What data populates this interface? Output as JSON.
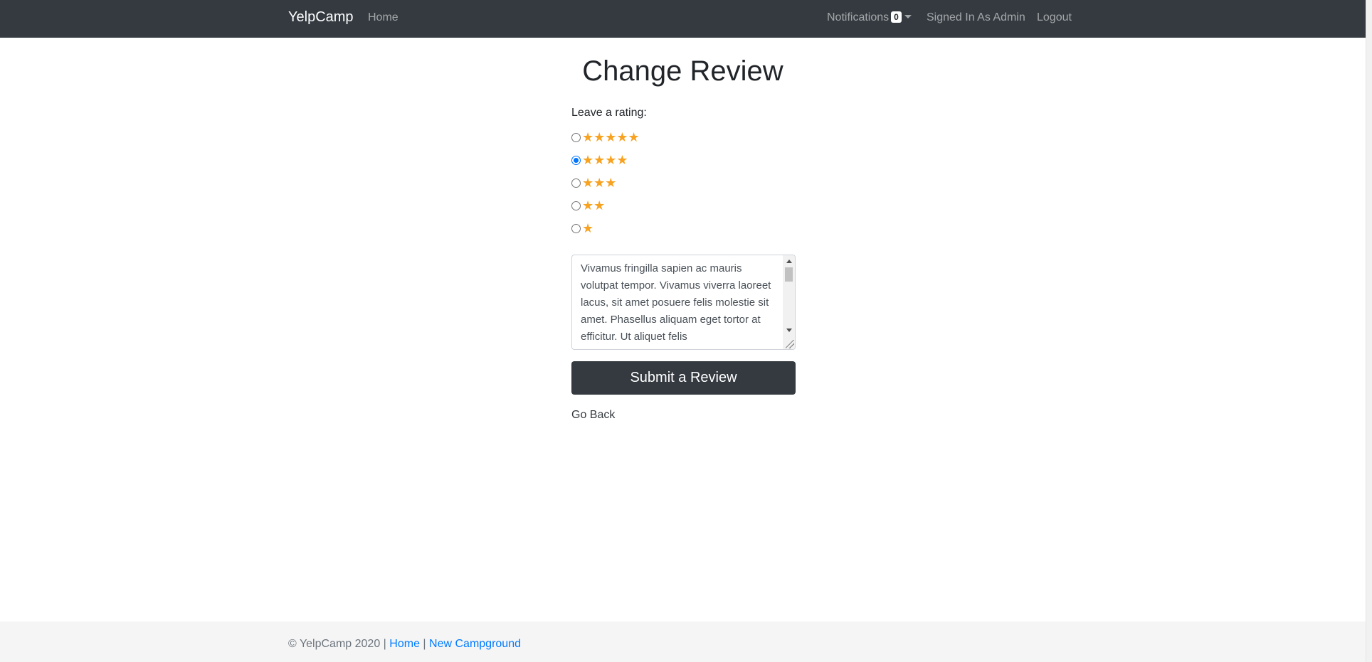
{
  "nav": {
    "brand": "YelpCamp",
    "home": "Home",
    "notifications": "Notifications",
    "notification_count": "0",
    "signed_in": "Signed In As Admin",
    "logout": "Logout"
  },
  "page": {
    "title": "Change Review",
    "rating_label": "Leave a rating:",
    "ratings": [
      {
        "stars": "★★★★★",
        "value": 5,
        "selected": false
      },
      {
        "stars": "★★★★",
        "value": 4,
        "selected": true
      },
      {
        "stars": "★★★",
        "value": 3,
        "selected": false
      },
      {
        "stars": "★★",
        "value": 2,
        "selected": false
      },
      {
        "stars": "★",
        "value": 1,
        "selected": false
      }
    ],
    "review_text": "Vivamus fringilla sapien ac mauris volutpat tempor. Vivamus viverra laoreet lacus, sit amet posuere felis molestie sit amet. Phasellus aliquam eget tortor at efficitur. Ut aliquet felis",
    "submit_label": "Submit a Review",
    "go_back": "Go Back",
    "star_color": "#f7a220"
  },
  "footer": {
    "copyright": "© YelpCamp 2020 |",
    "separator": "|",
    "home_link": "Home",
    "new_campground_link": "New Campground"
  }
}
